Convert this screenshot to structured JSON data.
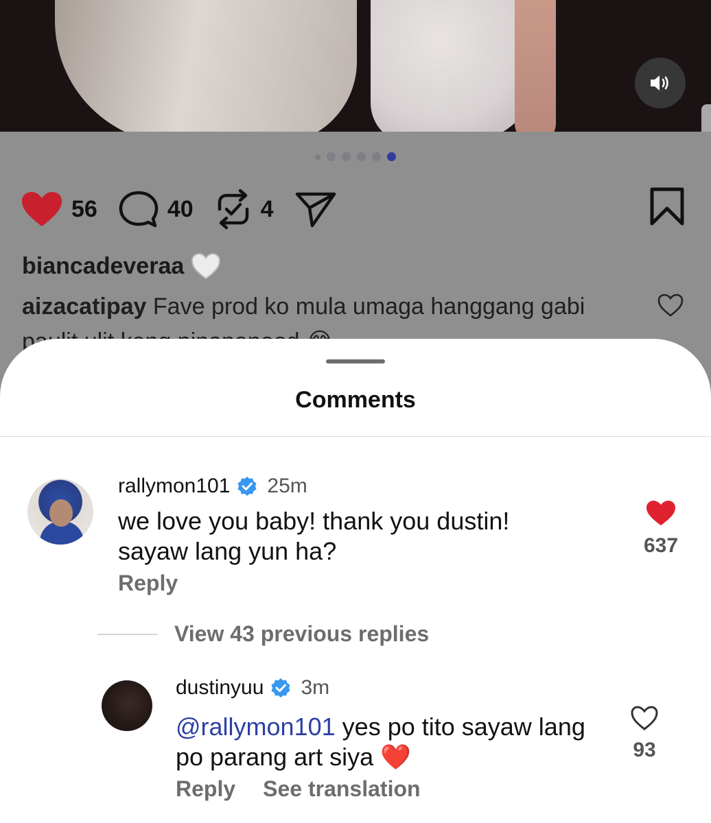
{
  "post": {
    "carousel": {
      "total": 6,
      "active_index": 5
    },
    "likes": "56",
    "comments": "40",
    "reposts": "4",
    "author": "biancadeveraa",
    "preview_comment": {
      "user": "aizacatipay",
      "text_line1": "Fave prod ko mula umaga hanggang gabi",
      "text_line2": "paulit ulit kong pinapanood 😂"
    },
    "icons": {
      "like": "heart-filled-icon",
      "comment": "speech-bubble-icon",
      "repost": "repost-icon",
      "share": "paper-plane-icon",
      "save": "bookmark-icon",
      "sound": "speaker-icon"
    }
  },
  "sheet": {
    "title": "Comments",
    "comments": [
      {
        "user": "rallymon101",
        "verified": true,
        "time": "25m",
        "text_line1": "we love you baby! thank you dustin!",
        "text_line2": "sayaw lang yun ha?",
        "reply_label": "Reply",
        "likes": "637",
        "liked": true
      }
    ],
    "view_replies_label": "View 43 previous replies",
    "replies": [
      {
        "user": "dustinyuu",
        "verified": true,
        "time": "3m",
        "mention": "@rallymon101",
        "text_line1": "yes po tito sayaw lang",
        "text_line2": "po parang art siya ❤️",
        "reply_label": "Reply",
        "translation_label": "See translation",
        "likes": "93",
        "liked": false
      }
    ]
  },
  "colors": {
    "like_red": "#e0212f",
    "verified_blue": "#3897f0",
    "mention_blue": "#2d3fa5",
    "active_dot": "#2f3d9b"
  }
}
